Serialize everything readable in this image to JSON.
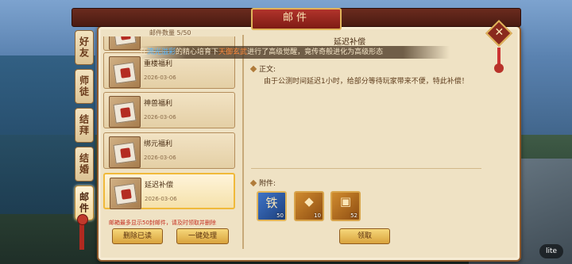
{
  "window": {
    "title": "邮件"
  },
  "side_tabs": [
    {
      "label": "好友",
      "active": false
    },
    {
      "label": "师徒",
      "active": false
    },
    {
      "label": "结拜",
      "active": false
    },
    {
      "label": "结婚",
      "active": false
    },
    {
      "label": "邮件",
      "active": true
    }
  ],
  "mail_list": {
    "count_label": "邮件数量 5/50",
    "items": [
      {
        "title": "",
        "date": "",
        "selected": false
      },
      {
        "title": "重楼福利",
        "date": "2026-03-06",
        "selected": false
      },
      {
        "title": "神兽福利",
        "date": "2026-03-06",
        "selected": false
      },
      {
        "title": "绑元福利",
        "date": "2026-03-06",
        "selected": false
      },
      {
        "title": "延迟补偿",
        "date": "2026-03-06",
        "selected": true
      }
    ],
    "note": "邮箱最多显示50封邮件，请及时领取并删除",
    "delete_read_label": "删除已读",
    "one_click_label": "一键处理"
  },
  "announcement": {
    "prefix": "在",
    "name1": "流光溢彩",
    "mid1": "的精心培育下",
    "name2": "天御玄武",
    "suffix": "进行了高级觉醒，竟传奇般进化为高级形态"
  },
  "detail": {
    "title": "延迟补偿",
    "body_label": "正文:",
    "body": "由于公测时间延迟1小时，给部分等待玩家带来不便，特此补偿！",
    "attachments_label": "附件:",
    "attachments": [
      {
        "icon": "iron-token-icon",
        "glyph": "铁",
        "count": "50"
      },
      {
        "icon": "gold-ingot-icon",
        "glyph": "◆",
        "count": "10"
      },
      {
        "icon": "treasure-chest-icon",
        "glyph": "▣",
        "count": "52"
      }
    ],
    "claim_label": "领取"
  },
  "colors": {
    "accent": "#b1342b",
    "highlight_blue": "#55b7ff",
    "highlight_orange": "#ff8a3b",
    "note_red": "#c42b1e"
  },
  "corner": {
    "label": "lite"
  }
}
